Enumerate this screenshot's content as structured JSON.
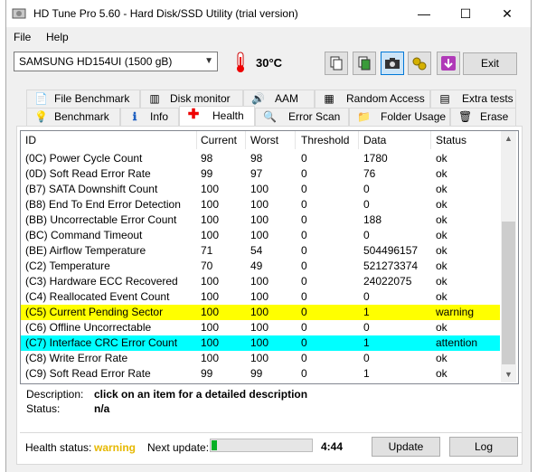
{
  "window": {
    "title": "HD Tune Pro 5.60 - Hard Disk/SSD Utility (trial version)",
    "controls": {
      "minimize": "—",
      "maximize": "☐",
      "close": "✕"
    }
  },
  "menu": {
    "file": "File",
    "help": "Help"
  },
  "toolbar": {
    "drive": "SAMSUNG HD154UI (1500 gB)",
    "temperature": "30°C",
    "exit_label": "Exit",
    "icons": [
      "copy-icon",
      "copy-screenshot-icon",
      "camera-icon",
      "options-icon",
      "save-down-icon"
    ]
  },
  "tabs_top": [
    {
      "label": "File Benchmark",
      "icon": "file-benchmark-icon"
    },
    {
      "label": "Disk monitor",
      "icon": "disk-monitor-icon"
    },
    {
      "label": "AAM",
      "icon": "speaker-icon"
    },
    {
      "label": "Random Access",
      "icon": "random-access-icon"
    },
    {
      "label": "Extra tests",
      "icon": "extra-tests-icon"
    }
  ],
  "tabs_bottom": [
    {
      "label": "Benchmark",
      "icon": "benchmark-icon"
    },
    {
      "label": "Info",
      "icon": "info-icon"
    },
    {
      "label": "Health",
      "icon": "health-cross-icon",
      "selected": true
    },
    {
      "label": "Error Scan",
      "icon": "magnifier-icon"
    },
    {
      "label": "Folder Usage",
      "icon": "folder-icon"
    },
    {
      "label": "Erase",
      "icon": "trash-icon"
    }
  ],
  "table": {
    "columns": [
      "ID",
      "Current",
      "Worst",
      "Threshold",
      "Data",
      "Status"
    ],
    "rows": [
      {
        "id": "(0C) Power Cycle Count",
        "current": "98",
        "worst": "98",
        "threshold": "0",
        "data": "1780",
        "status": "ok",
        "highlight": ""
      },
      {
        "id": "(0D) Soft Read Error Rate",
        "current": "99",
        "worst": "97",
        "threshold": "0",
        "data": "76",
        "status": "ok",
        "highlight": ""
      },
      {
        "id": "(B7) SATA Downshift Count",
        "current": "100",
        "worst": "100",
        "threshold": "0",
        "data": "0",
        "status": "ok",
        "highlight": ""
      },
      {
        "id": "(B8) End To End Error Detection",
        "current": "100",
        "worst": "100",
        "threshold": "0",
        "data": "0",
        "status": "ok",
        "highlight": ""
      },
      {
        "id": "(BB) Uncorrectable Error Count",
        "current": "100",
        "worst": "100",
        "threshold": "0",
        "data": "188",
        "status": "ok",
        "highlight": ""
      },
      {
        "id": "(BC) Command Timeout",
        "current": "100",
        "worst": "100",
        "threshold": "0",
        "data": "0",
        "status": "ok",
        "highlight": ""
      },
      {
        "id": "(BE) Airflow Temperature",
        "current": "71",
        "worst": "54",
        "threshold": "0",
        "data": "504496157",
        "status": "ok",
        "highlight": ""
      },
      {
        "id": "(C2) Temperature",
        "current": "70",
        "worst": "49",
        "threshold": "0",
        "data": "521273374",
        "status": "ok",
        "highlight": ""
      },
      {
        "id": "(C3) Hardware ECC Recovered",
        "current": "100",
        "worst": "100",
        "threshold": "0",
        "data": "24022075",
        "status": "ok",
        "highlight": ""
      },
      {
        "id": "(C4) Reallocated Event Count",
        "current": "100",
        "worst": "100",
        "threshold": "0",
        "data": "0",
        "status": "ok",
        "highlight": ""
      },
      {
        "id": "(C5) Current Pending Sector",
        "current": "100",
        "worst": "100",
        "threshold": "0",
        "data": "1",
        "status": "warning",
        "highlight": "yellow"
      },
      {
        "id": "(C6) Offline Uncorrectable",
        "current": "100",
        "worst": "100",
        "threshold": "0",
        "data": "0",
        "status": "ok",
        "highlight": ""
      },
      {
        "id": "(C7) Interface CRC Error Count",
        "current": "100",
        "worst": "100",
        "threshold": "0",
        "data": "1",
        "status": "attention",
        "highlight": "cyan"
      },
      {
        "id": "(C8) Write Error Rate",
        "current": "100",
        "worst": "100",
        "threshold": "0",
        "data": "0",
        "status": "ok",
        "highlight": ""
      },
      {
        "id": "(C9) Soft Read Error Rate",
        "current": "99",
        "worst": "99",
        "threshold": "0",
        "data": "1",
        "status": "ok",
        "highlight": ""
      }
    ]
  },
  "description": {
    "label": "Description:",
    "value": "click on an item for a detailed description",
    "status_label": "Status:",
    "status_value": "n/a"
  },
  "footer": {
    "health_label": "Health status:",
    "health_value": "warning",
    "next_update_label": "Next update:",
    "next_update_time": "4:44",
    "progress_fraction": 0.05,
    "update_label": "Update",
    "log_label": "Log"
  },
  "colors": {
    "warning_row": "#ffff00",
    "attention_row": "#00ffff",
    "health_warning": "#e6b800",
    "progress": "#06b025"
  }
}
